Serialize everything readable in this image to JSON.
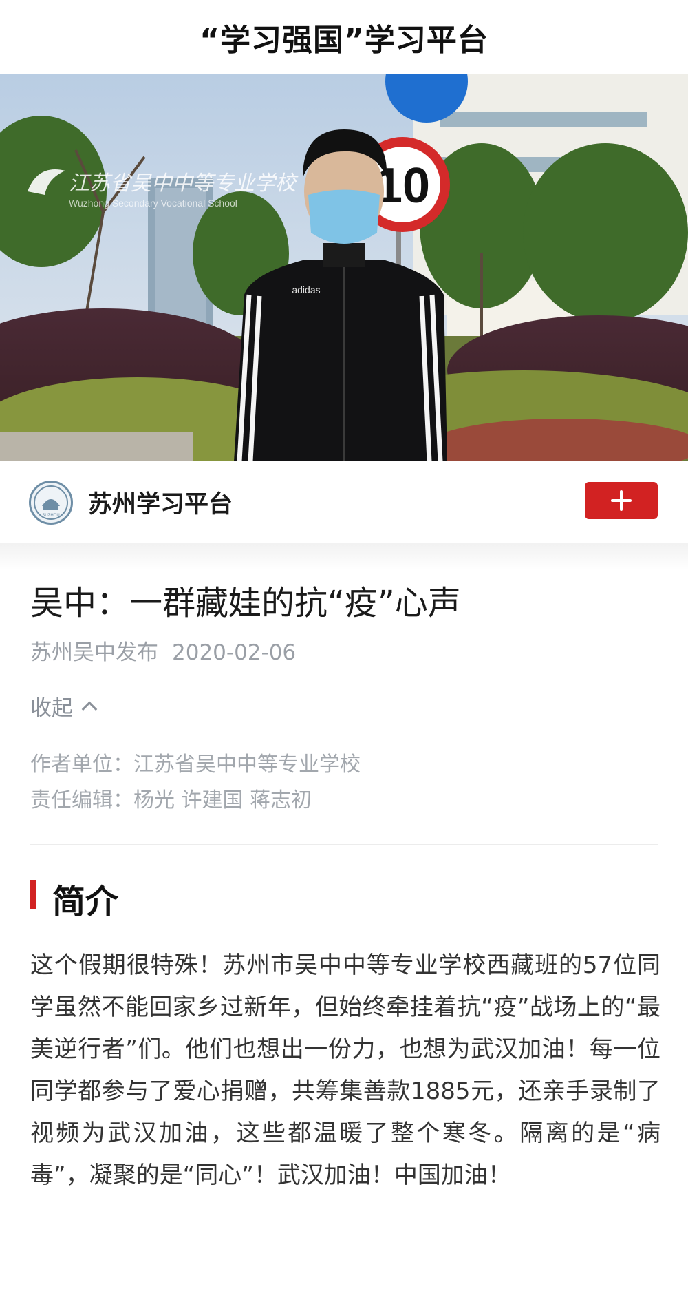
{
  "app": {
    "title": "“学习强国”学习平台"
  },
  "video": {
    "watermark": "江苏省吴中中等专业学校",
    "watermark_en": "Wuzhong Secondary Vocational School",
    "speed_sign": "10",
    "jacket_brand": "adidas"
  },
  "channel": {
    "name": "苏州学习平台",
    "logo_icon": "suzhou-platform-logo-icon",
    "logo_text": "SUZHOU",
    "subscribe_icon": "plus-icon"
  },
  "article": {
    "title": "吴中：一群藏娃的抗“疫”心声",
    "source": "苏州吴中发布",
    "date": "2020-02-06",
    "collapse_label": "收起",
    "author_unit": "作者单位：江苏省吴中中等专业学校",
    "editors": "责任编辑：杨光 许建国 蒋志初"
  },
  "intro": {
    "heading": "简介",
    "text": "这个假期很特殊！苏州市吴中中等专业学校西藏班的57位同学虽然不能回家乡过新年，但始终牵挂着抗“疫”战场上的“最美逆行者”们。他们也想出一份力，也想为武汉加油！每一位同学都参与了爱心捐赠，共筹集善款1885元，还亲手录制了视频为武汉加油，这些都温暖了整个寒冬。隔离的是“病毒”，凝聚的是“同心”！武汉加油！中国加油！"
  },
  "colors": {
    "accent": "#d22222",
    "meta": "#9a9fa6"
  }
}
